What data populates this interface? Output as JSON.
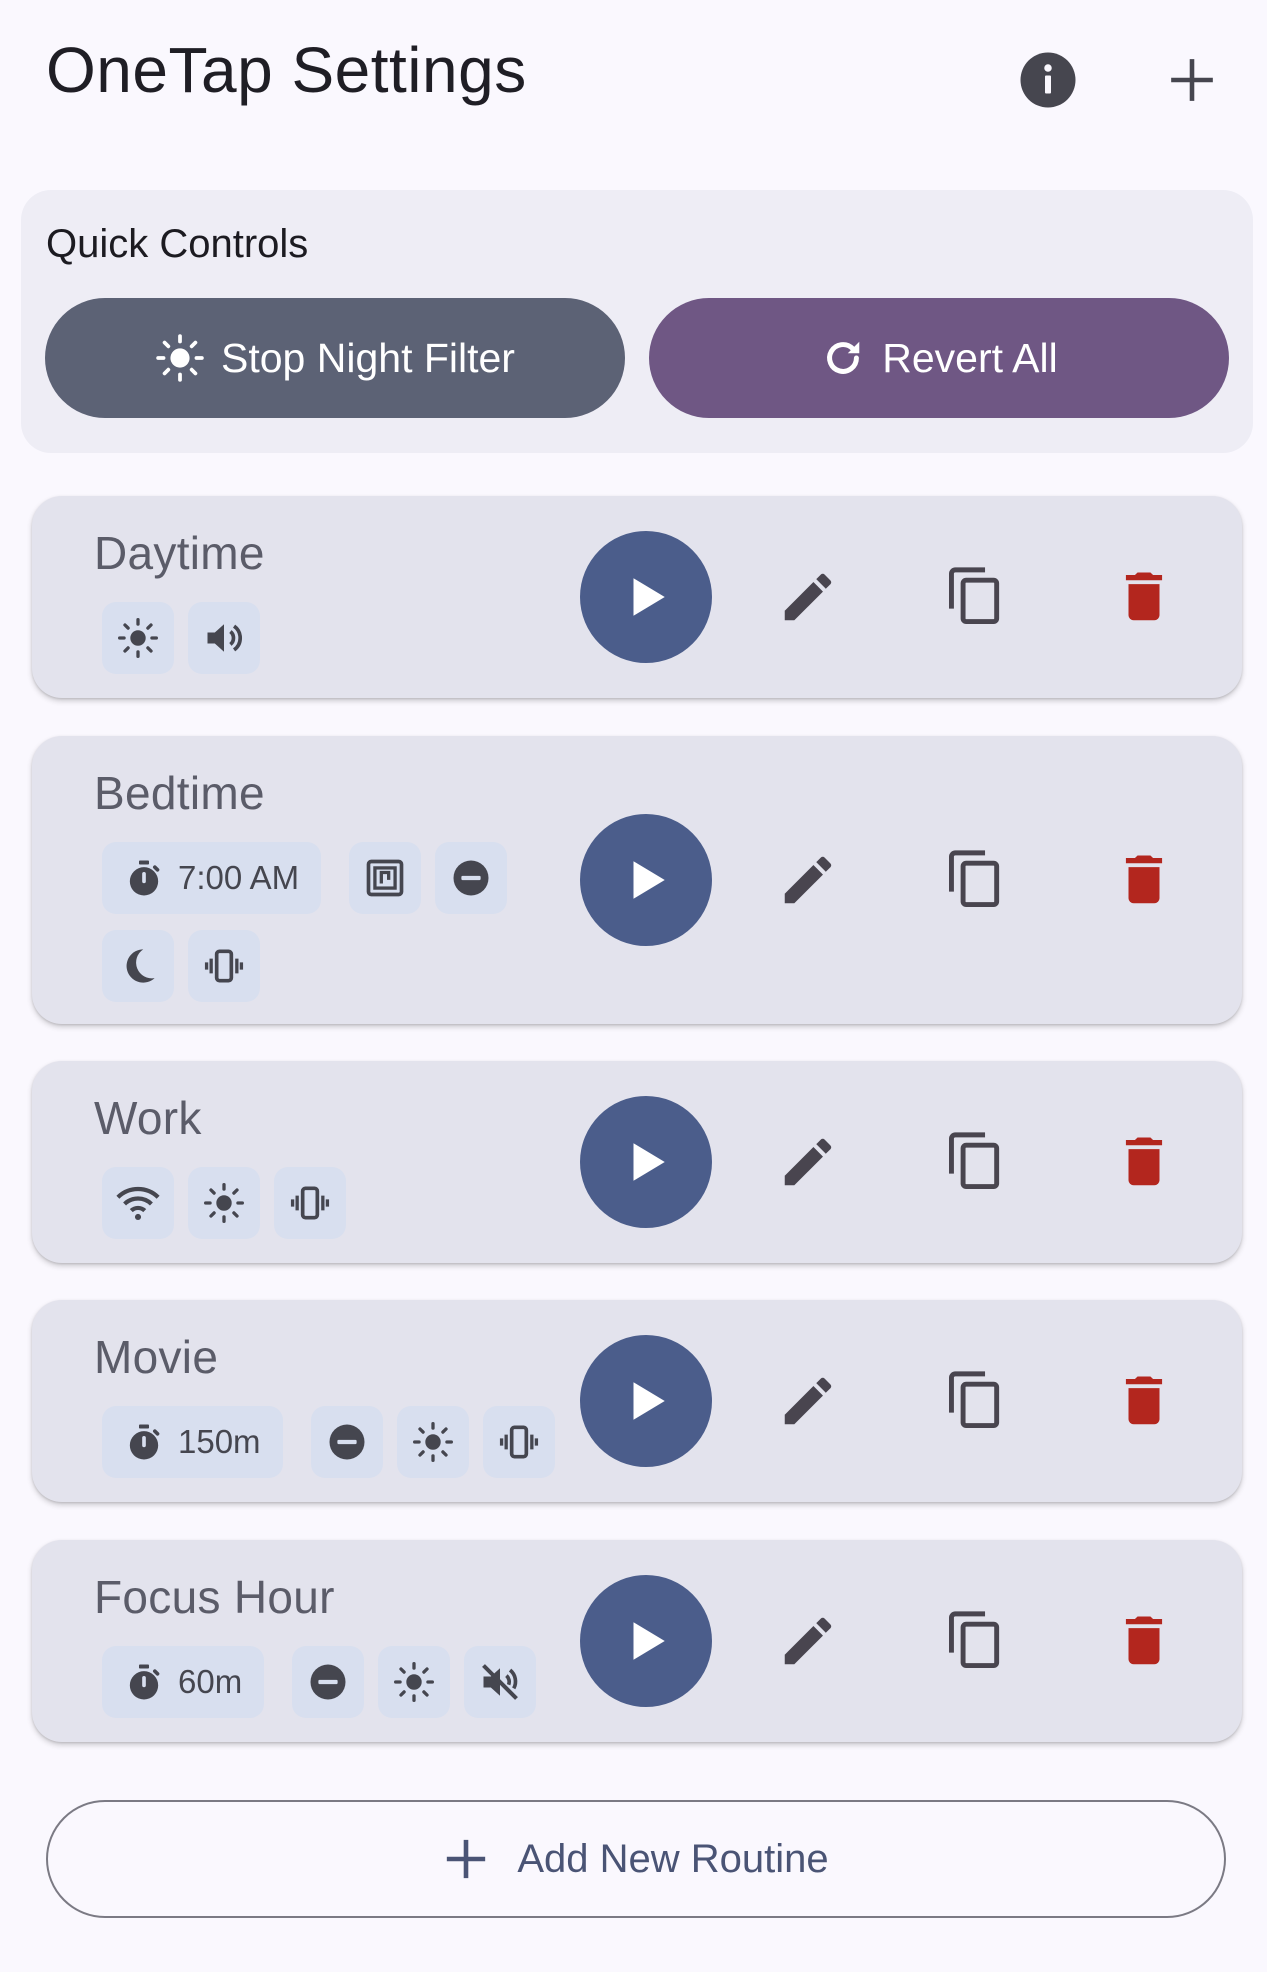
{
  "header": {
    "title": "OneTap Settings",
    "info_icon": "info-icon",
    "add_icon": "plus-icon"
  },
  "quick_controls": {
    "title": "Quick Controls",
    "stop_night_filter": "Stop Night Filter",
    "revert_all": "Revert All"
  },
  "routines": [
    {
      "name": "Daytime",
      "chips": [
        {
          "icon": "brightness-icon"
        },
        {
          "icon": "volume-icon"
        }
      ]
    },
    {
      "name": "Bedtime",
      "chips": [
        {
          "icon": "timer-icon",
          "label": "7:00 AM"
        },
        {
          "icon": "nfc-icon"
        },
        {
          "icon": "do-not-disturb-icon"
        },
        {
          "icon": "dark-mode-icon"
        },
        {
          "icon": "vibrate-icon"
        }
      ]
    },
    {
      "name": "Work",
      "chips": [
        {
          "icon": "wifi-icon"
        },
        {
          "icon": "brightness-icon"
        },
        {
          "icon": "vibrate-icon"
        }
      ]
    },
    {
      "name": "Movie",
      "chips": [
        {
          "icon": "timer-icon",
          "label": "150m"
        },
        {
          "icon": "do-not-disturb-icon"
        },
        {
          "icon": "brightness-icon"
        },
        {
          "icon": "vibrate-icon"
        }
      ]
    },
    {
      "name": "Focus Hour",
      "chips": [
        {
          "icon": "timer-icon",
          "label": "60m"
        },
        {
          "icon": "do-not-disturb-icon"
        },
        {
          "icon": "brightness-icon"
        },
        {
          "icon": "mute-icon"
        }
      ]
    }
  ],
  "add_routine": {
    "label": "Add New Routine"
  },
  "colors": {
    "play": "#4b5d8b",
    "delete": "#b3261e",
    "night_filter": "#5c6275",
    "revert": "#6f5784"
  }
}
